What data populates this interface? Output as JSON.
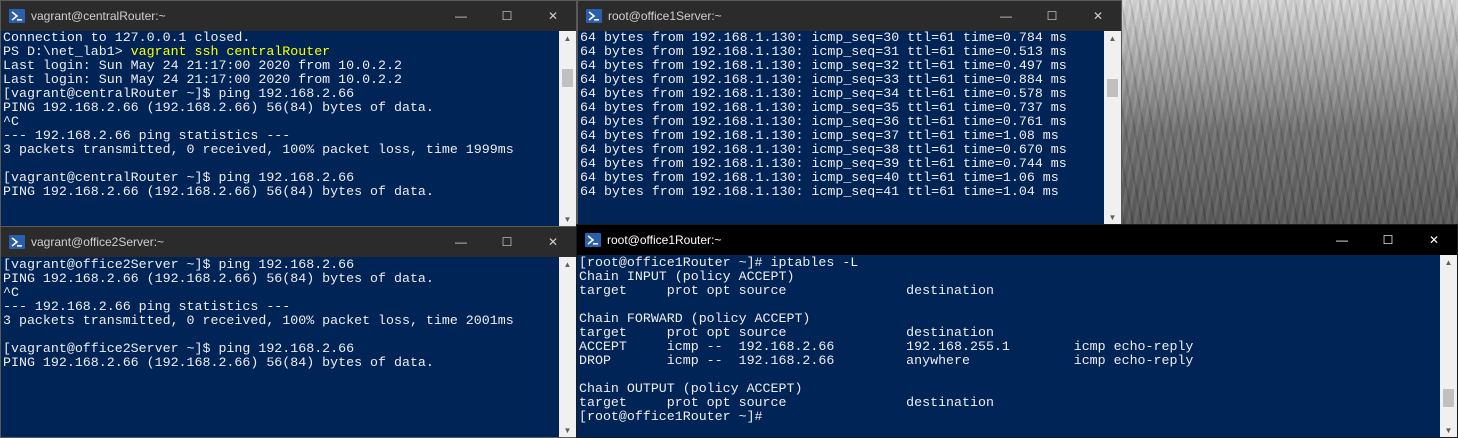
{
  "windows": {
    "central": {
      "title": "vagrant@centralRouter:~",
      "lines": [
        {
          "t": "Connection to 127.0.0.1 closed."
        },
        {
          "p": "PS D:\\net_lab1> ",
          "c": "vagrant ssh centralRouter"
        },
        {
          "t": "Last login: Sun May 24 21:17:00 2020 from 10.0.2.2"
        },
        {
          "t": "Last login: Sun May 24 21:17:00 2020 from 10.0.2.2"
        },
        {
          "t": "[vagrant@centralRouter ~]$ ping 192.168.2.66"
        },
        {
          "t": "PING 192.168.2.66 (192.168.2.66) 56(84) bytes of data."
        },
        {
          "t": "^C"
        },
        {
          "t": "--- 192.168.2.66 ping statistics ---"
        },
        {
          "t": "3 packets transmitted, 0 received, 100% packet loss, time 1999ms"
        },
        {
          "t": ""
        },
        {
          "t": "[vagrant@centralRouter ~]$ ping 192.168.2.66"
        },
        {
          "t": "PING 192.168.2.66 (192.168.2.66) 56(84) bytes of data."
        }
      ]
    },
    "office1server": {
      "title": "root@office1Server:~",
      "lines": [
        {
          "t": "64 bytes from 192.168.1.130: icmp_seq=30 ttl=61 time=0.784 ms"
        },
        {
          "t": "64 bytes from 192.168.1.130: icmp_seq=31 ttl=61 time=0.513 ms"
        },
        {
          "t": "64 bytes from 192.168.1.130: icmp_seq=32 ttl=61 time=0.497 ms"
        },
        {
          "t": "64 bytes from 192.168.1.130: icmp_seq=33 ttl=61 time=0.884 ms"
        },
        {
          "t": "64 bytes from 192.168.1.130: icmp_seq=34 ttl=61 time=0.578 ms"
        },
        {
          "t": "64 bytes from 192.168.1.130: icmp_seq=35 ttl=61 time=0.737 ms"
        },
        {
          "t": "64 bytes from 192.168.1.130: icmp_seq=36 ttl=61 time=0.761 ms"
        },
        {
          "t": "64 bytes from 192.168.1.130: icmp_seq=37 ttl=61 time=1.08 ms"
        },
        {
          "t": "64 bytes from 192.168.1.130: icmp_seq=38 ttl=61 time=0.670 ms"
        },
        {
          "t": "64 bytes from 192.168.1.130: icmp_seq=39 ttl=61 time=0.744 ms"
        },
        {
          "t": "64 bytes from 192.168.1.130: icmp_seq=40 ttl=61 time=1.06 ms"
        },
        {
          "t": "64 bytes from 192.168.1.130: icmp_seq=41 ttl=61 time=1.04 ms"
        }
      ]
    },
    "office2server": {
      "title": "vagrant@office2Server:~",
      "lines": [
        {
          "t": "[vagrant@office2Server ~]$ ping 192.168.2.66"
        },
        {
          "t": "PING 192.168.2.66 (192.168.2.66) 56(84) bytes of data."
        },
        {
          "t": "^C"
        },
        {
          "t": "--- 192.168.2.66 ping statistics ---"
        },
        {
          "t": "3 packets transmitted, 0 received, 100% packet loss, time 2001ms"
        },
        {
          "t": ""
        },
        {
          "t": "[vagrant@office2Server ~]$ ping 192.168.2.66"
        },
        {
          "t": "PING 192.168.2.66 (192.168.2.66) 56(84) bytes of data."
        }
      ]
    },
    "office1router": {
      "title": "root@office1Router:~",
      "lines": [
        {
          "t": "[root@office1Router ~]# iptables -L"
        },
        {
          "t": "Chain INPUT (policy ACCEPT)"
        },
        {
          "t": "target     prot opt source               destination"
        },
        {
          "t": ""
        },
        {
          "t": "Chain FORWARD (policy ACCEPT)"
        },
        {
          "t": "target     prot opt source               destination"
        },
        {
          "t": "ACCEPT     icmp --  192.168.2.66         192.168.255.1        icmp echo-reply"
        },
        {
          "t": "DROP       icmp --  192.168.2.66         anywhere             icmp echo-reply"
        },
        {
          "t": ""
        },
        {
          "t": "Chain OUTPUT (policy ACCEPT)"
        },
        {
          "t": "target     prot opt source               destination"
        },
        {
          "t": "[root@office1Router ~]#"
        }
      ]
    }
  },
  "controls": {
    "minimize": "—",
    "maximize": "☐",
    "close": "✕",
    "scroll_up": "▲",
    "scroll_down": "▼"
  },
  "colors": {
    "terminal_bg": "#012456",
    "terminal_fg": "#eeedf0",
    "command_highlight": "#ffff00",
    "titlebar_active": "#000000",
    "titlebar_inactive": "#2b2b2b"
  }
}
